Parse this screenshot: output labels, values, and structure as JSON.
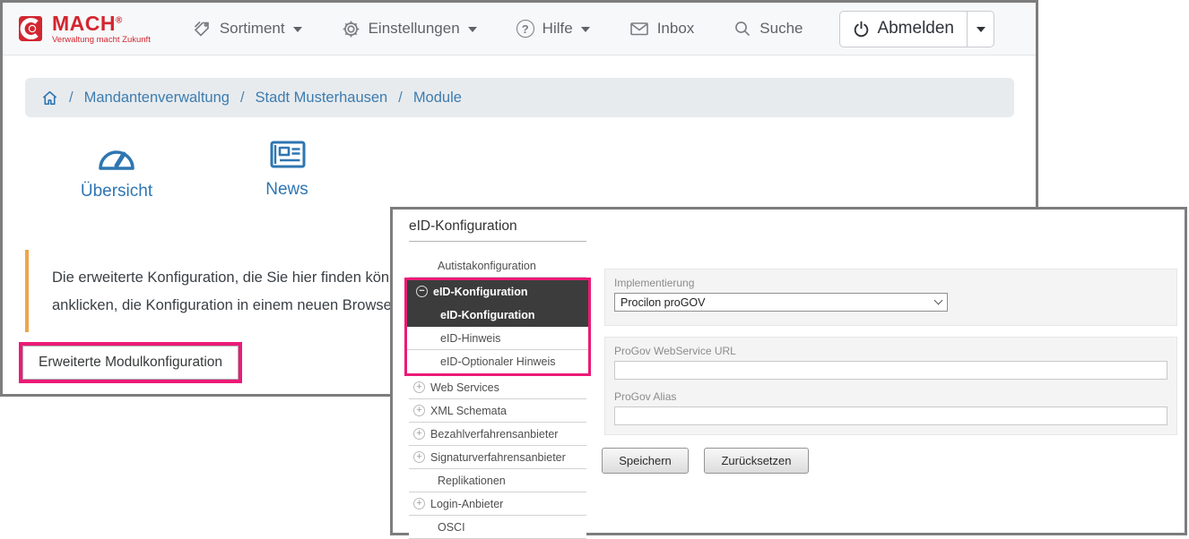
{
  "app": {
    "logo": {
      "name": "MACH",
      "reg": "®",
      "tagline": "Verwaltung macht Zukunft"
    },
    "nav": [
      {
        "label": "Sortiment",
        "icon": "tag-icon",
        "has_caret": true
      },
      {
        "label": "Einstellungen",
        "icon": "gear-icon",
        "has_caret": true
      },
      {
        "label": "Hilfe",
        "icon": "help-circle-icon",
        "has_caret": true
      },
      {
        "label": "Inbox",
        "icon": "envelope-icon",
        "has_caret": false
      },
      {
        "label": "Suche",
        "icon": "search-icon",
        "has_caret": false
      }
    ],
    "logout": {
      "label": "Abmelden",
      "icon": "power-icon"
    },
    "help_glyph": "?"
  },
  "breadcrumb": {
    "separator": "/",
    "items": [
      "Mandantenverwaltung",
      "Stadt Musterhausen",
      "Module"
    ]
  },
  "modules": [
    {
      "label": "Übersicht",
      "icon": "gauge-icon"
    },
    {
      "label": "News",
      "icon": "newspaper-icon"
    }
  ],
  "notice": {
    "line1": "Die erweiterte Konfiguration, die Sie hier finden könne",
    "line2": "anklicken, die Konfiguration in einem neuen Browserta"
  },
  "advanced_button": {
    "label": "Erweiterte Modulkonfiguration"
  },
  "dialog": {
    "title": "eID-Konfiguration",
    "tree": [
      {
        "label": "Autistakonfiguration",
        "icon": "none",
        "level": 1,
        "selected": false,
        "highlighted": false
      },
      {
        "label": "eID-Konfiguration",
        "icon": "minus-circle",
        "level": 0,
        "selected": true,
        "highlighted": true
      },
      {
        "label": "eID-Konfiguration",
        "icon": "none",
        "level": 1,
        "selected": true,
        "highlighted": true
      },
      {
        "label": "eID-Hinweis",
        "icon": "none",
        "level": 1,
        "selected": false,
        "highlighted": true
      },
      {
        "label": "eID-Optionaler Hinweis",
        "icon": "none",
        "level": 1,
        "selected": false,
        "highlighted": true
      },
      {
        "label": "Web Services",
        "icon": "plus-circle",
        "level": 0,
        "selected": false,
        "highlighted": false
      },
      {
        "label": "XML Schemata",
        "icon": "plus-circle",
        "level": 0,
        "selected": false,
        "highlighted": false
      },
      {
        "label": "Bezahlverfahrensanbieter",
        "icon": "plus-circle",
        "level": 0,
        "selected": false,
        "highlighted": false
      },
      {
        "label": "Signaturverfahrensanbieter",
        "icon": "plus-circle",
        "level": 0,
        "selected": false,
        "highlighted": false
      },
      {
        "label": "Replikationen",
        "icon": "none",
        "level": 1,
        "selected": false,
        "highlighted": false
      },
      {
        "label": "Login-Anbieter",
        "icon": "plus-circle",
        "level": 0,
        "selected": false,
        "highlighted": false
      },
      {
        "label": "OSCI",
        "icon": "none",
        "level": 1,
        "selected": false,
        "highlighted": false
      }
    ],
    "form": {
      "implementierung": {
        "label": "Implementierung",
        "value": "Procilon proGOV"
      },
      "webservice_url": {
        "label": "ProGov WebService URL",
        "value": ""
      },
      "alias": {
        "label": "ProGov Alias",
        "value": ""
      },
      "save_label": "Speichern",
      "reset_label": "Zurücksetzen"
    }
  },
  "colors": {
    "brand_red": "#d22630",
    "link_blue": "#3c7cb0",
    "icon_blue": "#2e76b2",
    "highlight_pink": "#ec1a77",
    "notice_orange": "#eca64a",
    "selection_dark": "#3c3c3c",
    "window_border": "#7d7d7d",
    "panel_gray": "#f4f4f4"
  }
}
